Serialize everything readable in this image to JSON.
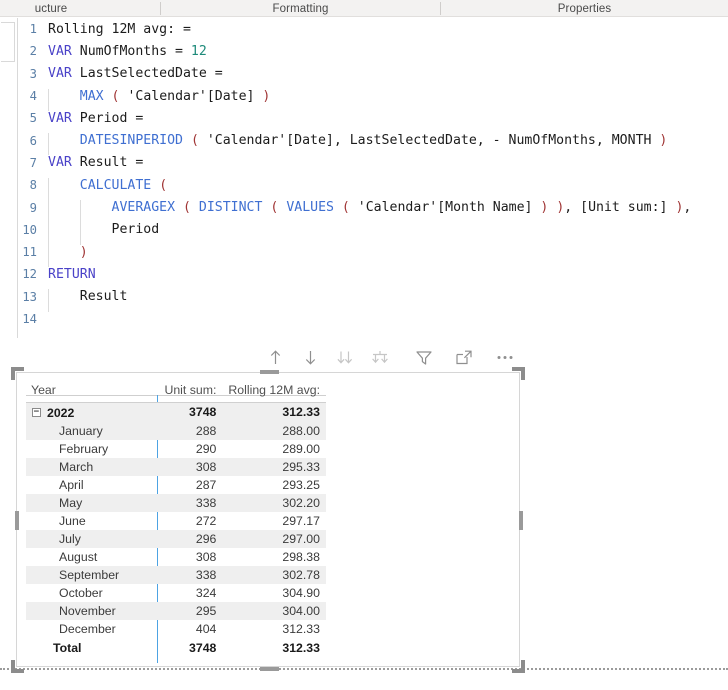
{
  "ribbon": {
    "tabs": [
      {
        "label": "ucture"
      },
      {
        "label": "Formatting"
      },
      {
        "label": "Properties"
      }
    ]
  },
  "editor": {
    "lines": [
      {
        "n": "1",
        "text": "Rolling 12M avg: ="
      },
      {
        "n": "2",
        "text": "VAR NumOfMonths = 12"
      },
      {
        "n": "3",
        "text": "VAR LastSelectedDate ="
      },
      {
        "n": "4",
        "text": "    MAX ( 'Calendar'[Date] )"
      },
      {
        "n": "5",
        "text": "VAR Period ="
      },
      {
        "n": "6",
        "text": "    DATESINPERIOD ( 'Calendar'[Date], LastSelectedDate, - NumOfMonths, MONTH )"
      },
      {
        "n": "7",
        "text": "VAR Result ="
      },
      {
        "n": "8",
        "text": "    CALCULATE ("
      },
      {
        "n": "9",
        "text": "        AVERAGEX ( DISTINCT ( VALUES ( 'Calendar'[Month Name] ) ), [Unit sum:] ),"
      },
      {
        "n": "10",
        "text": "        Period"
      },
      {
        "n": "11",
        "text": "    )"
      },
      {
        "n": "12",
        "text": "RETURN"
      },
      {
        "n": "13",
        "text": "    Result"
      },
      {
        "n": "14",
        "text": ""
      }
    ]
  },
  "visual_toolbar": {
    "buttons": [
      {
        "name": "drill-up-icon",
        "title": "Drill up"
      },
      {
        "name": "drill-down-icon",
        "title": "Go to the next level in the hierarchy"
      },
      {
        "name": "expand-all-down-icon",
        "title": "Expand all down one level in the hierarchy"
      },
      {
        "name": "drill-on-icon",
        "title": "Drill on"
      },
      {
        "name": "filter-icon",
        "title": "Filters"
      },
      {
        "name": "focus-mode-icon",
        "title": "Focus mode"
      },
      {
        "name": "more-options-icon",
        "title": "More options"
      }
    ]
  },
  "matrix": {
    "columns": [
      "Year",
      "Unit sum:",
      "Rolling 12M avg:"
    ],
    "group": {
      "label": "2022",
      "expanded": true,
      "unit_sum": "3748",
      "rolling": "312.33"
    },
    "rows": [
      {
        "label": "January",
        "unit_sum": "288",
        "rolling": "288.00"
      },
      {
        "label": "February",
        "unit_sum": "290",
        "rolling": "289.00"
      },
      {
        "label": "March",
        "unit_sum": "308",
        "rolling": "295.33"
      },
      {
        "label": "April",
        "unit_sum": "287",
        "rolling": "293.25"
      },
      {
        "label": "May",
        "unit_sum": "338",
        "rolling": "302.20"
      },
      {
        "label": "June",
        "unit_sum": "272",
        "rolling": "297.17"
      },
      {
        "label": "July",
        "unit_sum": "296",
        "rolling": "297.00"
      },
      {
        "label": "August",
        "unit_sum": "308",
        "rolling": "298.38"
      },
      {
        "label": "September",
        "unit_sum": "338",
        "rolling": "302.78"
      },
      {
        "label": "October",
        "unit_sum": "324",
        "rolling": "304.90"
      },
      {
        "label": "November",
        "unit_sum": "295",
        "rolling": "304.00"
      },
      {
        "label": "December",
        "unit_sum": "404",
        "rolling": "312.33"
      }
    ],
    "total": {
      "label": "Total",
      "unit_sum": "3748",
      "rolling": "312.33"
    },
    "expander_glyph": "−"
  },
  "colors": {
    "keyword": "#4a42c8",
    "function": "#3f6fd1",
    "paren": "#a03535",
    "number": "#1d8a7a",
    "line_number": "#5b7fa6",
    "matrix_divider": "#4da3e3",
    "band": "#efefef"
  }
}
